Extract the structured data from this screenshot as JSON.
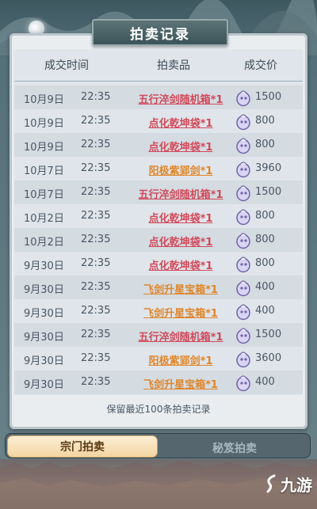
{
  "title": "拍卖记录",
  "columns": {
    "time": "成交时间",
    "item": "拍卖品",
    "price": "成交价"
  },
  "rows": [
    {
      "date": "10月9日",
      "time": "22:35",
      "item": "五行淬剑随机箱*1",
      "item_color": "red",
      "price": "1500"
    },
    {
      "date": "10月9日",
      "time": "22:35",
      "item": "点化乾坤袋*1",
      "item_color": "red",
      "price": "800"
    },
    {
      "date": "10月9日",
      "time": "22:35",
      "item": "点化乾坤袋*1",
      "item_color": "red",
      "price": "800"
    },
    {
      "date": "10月7日",
      "time": "22:35",
      "item": "阳极紫郢剑*1",
      "item_color": "orange",
      "price": "3960"
    },
    {
      "date": "10月7日",
      "time": "22:35",
      "item": "五行淬剑随机箱*1",
      "item_color": "red",
      "price": "1500"
    },
    {
      "date": "10月2日",
      "time": "22:35",
      "item": "点化乾坤袋*1",
      "item_color": "red",
      "price": "800"
    },
    {
      "date": "10月2日",
      "time": "22:35",
      "item": "点化乾坤袋*1",
      "item_color": "red",
      "price": "800"
    },
    {
      "date": "9月30日",
      "time": "22:35",
      "item": "点化乾坤袋*1",
      "item_color": "red",
      "price": "800"
    },
    {
      "date": "9月30日",
      "time": "22:35",
      "item": "飞剑升星宝箱*1",
      "item_color": "orange",
      "price": "400"
    },
    {
      "date": "9月30日",
      "time": "22:35",
      "item": "飞剑升星宝箱*1",
      "item_color": "orange",
      "price": "400"
    },
    {
      "date": "9月30日",
      "time": "22:35",
      "item": "五行淬剑随机箱*1",
      "item_color": "red",
      "price": "1500"
    },
    {
      "date": "9月30日",
      "time": "22:35",
      "item": "阳极紫郢剑*1",
      "item_color": "orange",
      "price": "3600"
    },
    {
      "date": "9月30日",
      "time": "22:35",
      "item": "飞剑升星宝箱*1",
      "item_color": "orange",
      "price": "400"
    }
  ],
  "footer_note": "保留最近100条拍卖记录",
  "tabs": {
    "active": "宗门拍卖",
    "inactive": "秘笈拍卖"
  },
  "watermark": "九游",
  "colors": {
    "red_item": "#d2495a",
    "orange_item": "#e0862a",
    "panel": "#e9edf0",
    "active_tab": "#f3d5a2"
  },
  "icons": {
    "currency": "spirit-stone-icon",
    "brand": "jiuyou-logo-icon"
  }
}
